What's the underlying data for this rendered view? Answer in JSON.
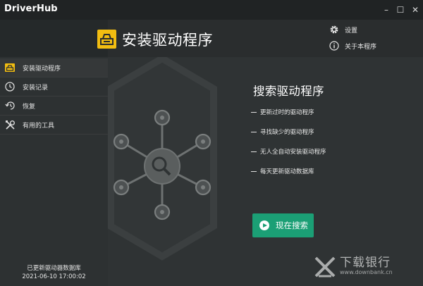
{
  "window": {
    "brand": "DriverHub",
    "controls": {
      "minimize": "–",
      "maximize": "☐",
      "close": "✕"
    }
  },
  "header": {
    "title": "安装驱动程序",
    "icon": "driver-install-icon",
    "settings_label": "设置",
    "about_label": "关于本程序"
  },
  "sidebar": {
    "items": [
      {
        "label": "安装驱动程序",
        "icon": "driver-icon",
        "active": true
      },
      {
        "label": "安装记录",
        "icon": "clock-icon",
        "active": false
      },
      {
        "label": "恢复",
        "icon": "restore-icon",
        "active": false
      },
      {
        "label": "有用的工具",
        "icon": "tools-icon",
        "active": false
      }
    ],
    "db_status_line1": "已更新驱动器数据库",
    "db_status_line2": "2021-06-10 17:00:02"
  },
  "main": {
    "search_title": "搜索驱动程序",
    "features": [
      "更新过时的驱动程序",
      "寻找缺少的驱动程序",
      "无人全自动安装驱动程序",
      "每天更新驱动数据库"
    ],
    "search_button": "现在搜索"
  },
  "watermark": {
    "cn": "下载银行",
    "en": "www.downbank.cn"
  },
  "colors": {
    "accent_green": "#1b9f75",
    "icon_yellow": "#f2bd11",
    "background": "#2f3233"
  }
}
